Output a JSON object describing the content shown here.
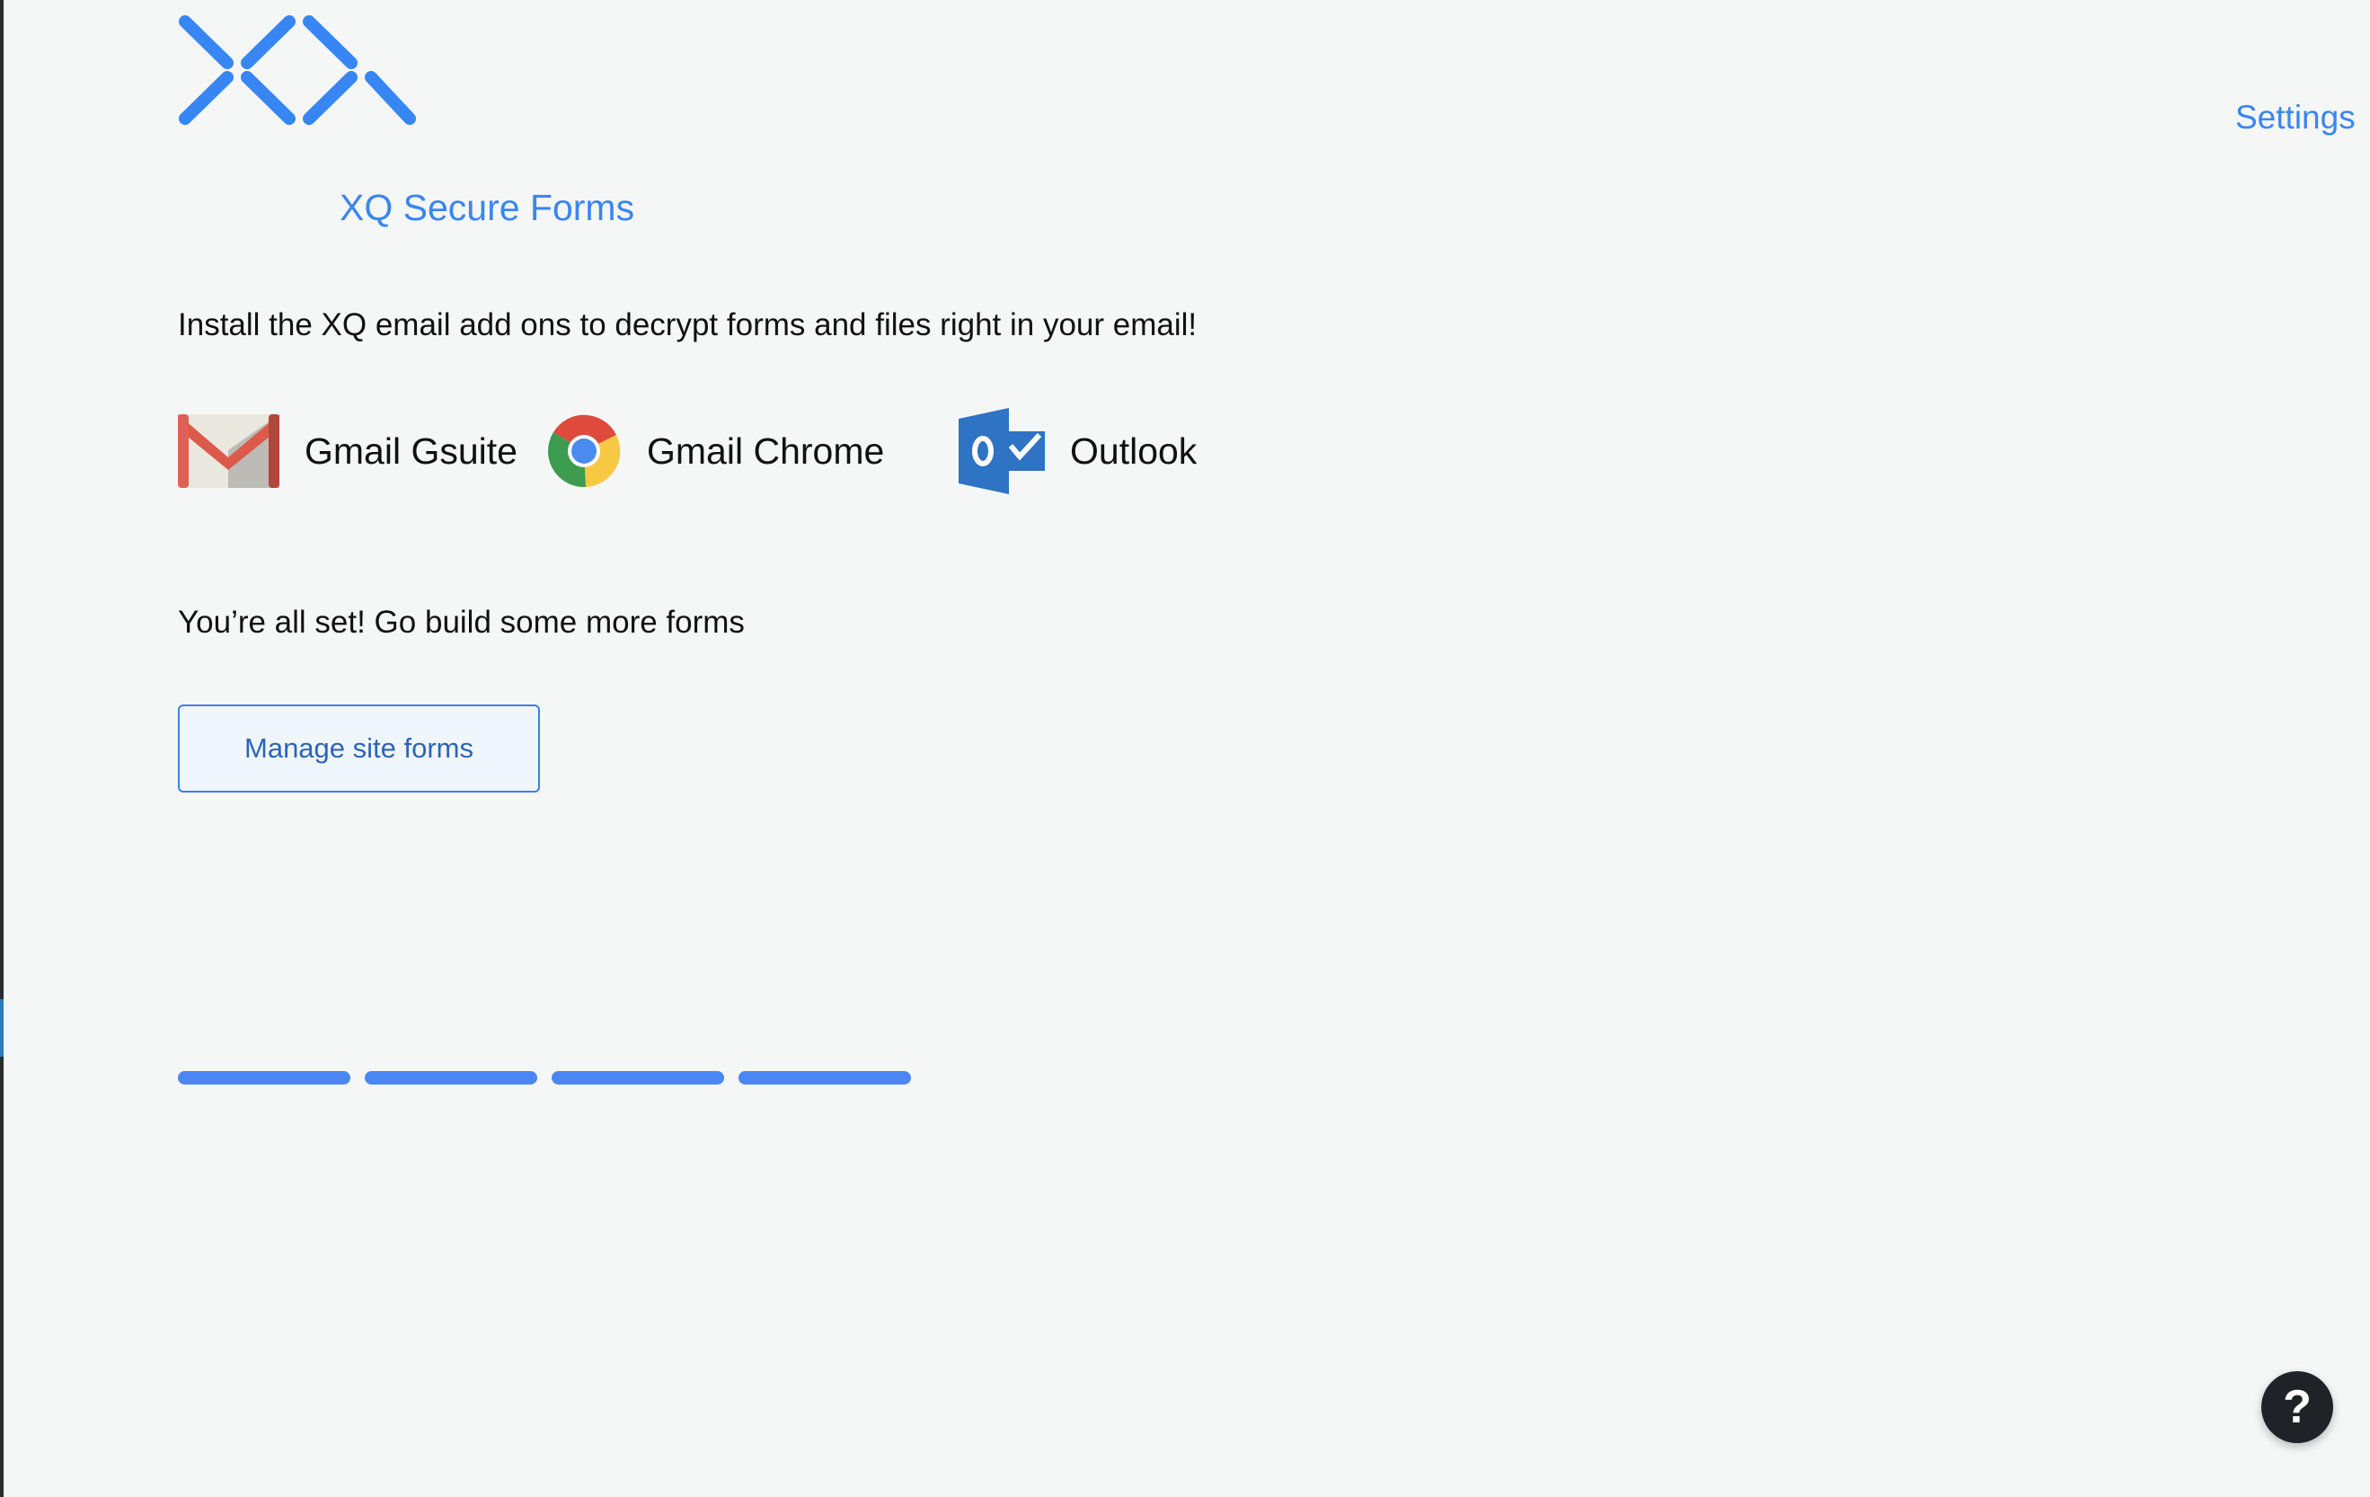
{
  "header": {
    "app_title": "XQ Secure Forms",
    "settings_link": "Settings",
    "logo_icon": "xq-logo-icon",
    "brand_color": "#3b86f0"
  },
  "install": {
    "message": "Install the XQ email add ons to decrypt forms and files right in your email!",
    "addons": [
      {
        "label": "Gmail Gsuite",
        "icon": "gmail-icon"
      },
      {
        "label": "Gmail Chrome",
        "icon": "chrome-icon"
      },
      {
        "label": "Outlook",
        "icon": "outlook-icon"
      }
    ]
  },
  "status": {
    "message": "You’re all set! Go build some more forms",
    "manage_button": "Manage site forms"
  },
  "progress": {
    "steps_total": 4,
    "steps_completed": 4,
    "color": "#4b87f4"
  },
  "help": {
    "label": "?",
    "icon": "help-icon"
  }
}
